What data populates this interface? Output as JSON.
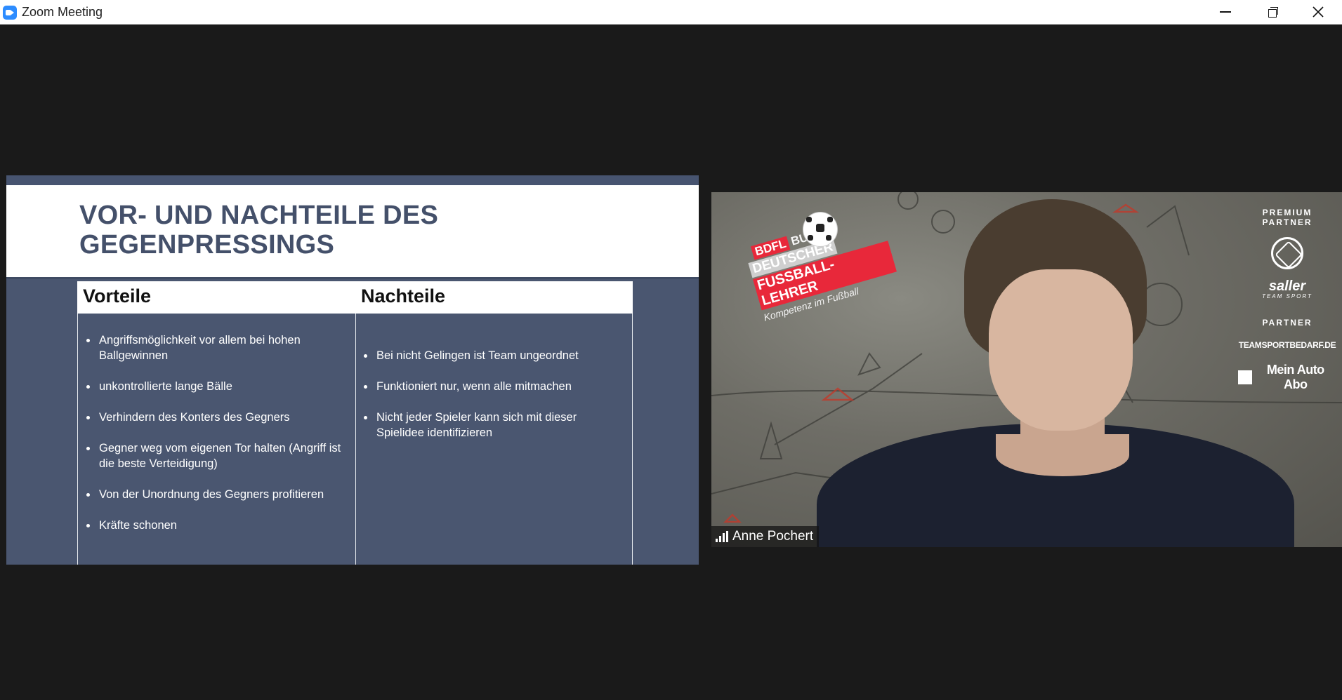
{
  "window": {
    "title": "Zoom Meeting"
  },
  "slide": {
    "title": "VOR- UND NACHTEILE DES GEGENPRESSINGS",
    "columns": [
      {
        "header": "Vorteile",
        "items": [
          "Angriffsmöglichkeit vor allem bei hohen Ballgewinnen",
          "unkontrollierte lange Bälle",
          "Verhindern des Konters des Gegners",
          "Gegner weg vom eigenen Tor halten (Angriff ist die beste Verteidigung)",
          "Von der Unordnung des Gegners profitieren",
          "Kräfte schonen"
        ]
      },
      {
        "header": "Nachteile",
        "items": [
          "Bei nicht Gelingen ist Team ungeordnet",
          "Funktioniert nur, wenn alle mitmachen",
          "Nicht jeder Spieler kann sich mit dieser Spielidee identifizieren"
        ]
      }
    ]
  },
  "video": {
    "participant_name": "Anne Pochert",
    "background_logo": {
      "line1a": "BDFL",
      "line1b": "BUND",
      "line2": "DEUTSCHER",
      "line3": "FUSSBALL-LEHRER",
      "line4": "Kompetenz im Fußball"
    },
    "sponsors": {
      "premium_label": "PREMIUM PARTNER",
      "saller": "saller",
      "saller_sub": "TEAM SPORT",
      "partner_label": "PARTNER",
      "teamsport": "TEAMSPORTBEDARF.DE",
      "autoabo": "Mein Auto Abo"
    }
  },
  "colors": {
    "slide_bg": "#4a5670",
    "slide_title": "#44506a",
    "zoom_blue": "#2d8cff",
    "stage_bg": "#1a1a1a"
  },
  "icons": [
    "zoom-app-icon",
    "minimize-icon",
    "restore-icon",
    "close-icon",
    "signal-strength-icon"
  ]
}
